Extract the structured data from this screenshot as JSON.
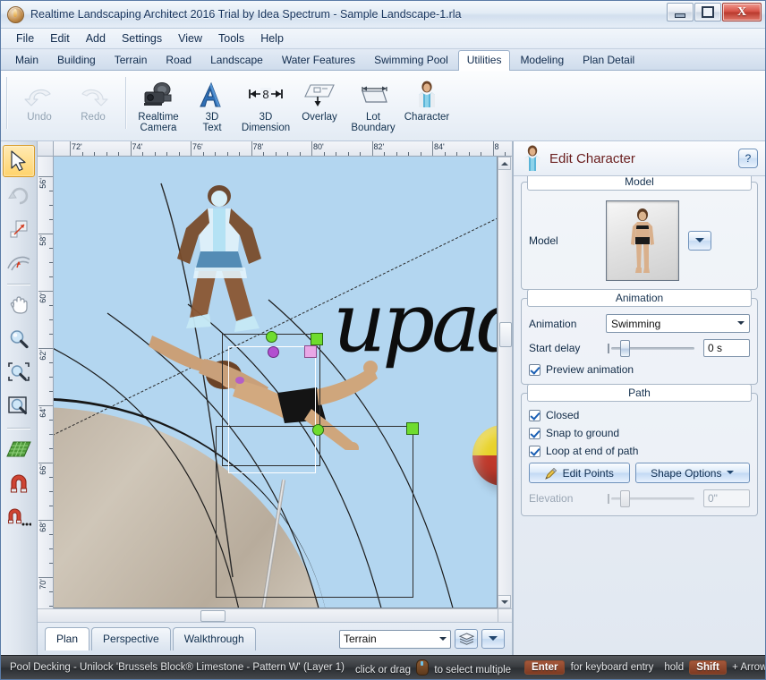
{
  "window": {
    "title": "Realtime Landscaping Architect 2016 Trial by Idea Spectrum - Sample Landscape-1.rla",
    "app_icon": "flame-icon",
    "minimize_label": "",
    "maximize_label": "",
    "close_label": "X"
  },
  "menubar": {
    "items": [
      {
        "label": "File"
      },
      {
        "label": "Edit"
      },
      {
        "label": "Add"
      },
      {
        "label": "Settings"
      },
      {
        "label": "View"
      },
      {
        "label": "Tools"
      },
      {
        "label": "Help"
      }
    ]
  },
  "ribbon": {
    "tabs": [
      {
        "label": "Main",
        "active": false
      },
      {
        "label": "Building",
        "active": false
      },
      {
        "label": "Terrain",
        "active": false
      },
      {
        "label": "Road",
        "active": false
      },
      {
        "label": "Landscape",
        "active": false
      },
      {
        "label": "Water Features",
        "active": false
      },
      {
        "label": "Swimming Pool",
        "active": false
      },
      {
        "label": "Utilities",
        "active": true
      },
      {
        "label": "Modeling",
        "active": false
      },
      {
        "label": "Plan Detail",
        "active": false
      }
    ]
  },
  "toolbar": {
    "buttons": [
      {
        "label": "Undo",
        "icon": "undo-arrow-icon",
        "disabled": true
      },
      {
        "label": "Redo",
        "icon": "redo-arrow-icon",
        "disabled": true
      },
      {
        "label": "Realtime\nCamera",
        "line1": "Realtime",
        "line2": "Camera",
        "icon": "video-camera-icon",
        "disabled": false
      },
      {
        "label": "3D Text",
        "line1": "3D",
        "line2": "Text",
        "icon": "letter-a-icon",
        "disabled": false
      },
      {
        "label": "3D Dimension",
        "line1": "3D",
        "line2": "Dimension",
        "icon": "dimension-arrows-icon",
        "disabled": false
      },
      {
        "label": "Overlay",
        "line1": "Overlay",
        "line2": "",
        "icon": "overlay-plan-icon",
        "disabled": false
      },
      {
        "label": "Lot Boundary",
        "line1": "Lot",
        "line2": "Boundary",
        "icon": "lot-boundary-icon",
        "disabled": false
      },
      {
        "label": "Character",
        "line1": "Character",
        "line2": "",
        "icon": "person-icon",
        "disabled": false
      }
    ],
    "dimension_value": "8"
  },
  "tools": [
    {
      "name": "select-arrow-tool",
      "active": true
    },
    {
      "name": "rotate-tool",
      "active": false
    },
    {
      "name": "scale-tool",
      "active": false
    },
    {
      "name": "curve-tool",
      "active": false
    },
    {
      "name": "pan-hand-tool",
      "active": false
    },
    {
      "name": "zoom-tool",
      "active": false
    },
    {
      "name": "zoom-region-tool",
      "active": false
    },
    {
      "name": "zoom-window-tool",
      "active": false
    },
    {
      "name": "grid-tool",
      "active": false
    },
    {
      "name": "magnet-snap-tool",
      "active": false
    },
    {
      "name": "magnet-options-tool",
      "active": false
    }
  ],
  "rulers": {
    "horizontal": [
      "72'",
      "74'",
      "76'",
      "78'",
      "80'",
      "82'",
      "84'",
      "8"
    ],
    "vertical": [
      "56'",
      "58'",
      "60'",
      "62'",
      "64'",
      "66'",
      "68'",
      "70'"
    ]
  },
  "canvas": {
    "overlay_text": "upad",
    "objects": [
      "character-standing",
      "character-swimming",
      "beach-ball",
      "pool-deck",
      "path-curves",
      "pole"
    ]
  },
  "viewbar": {
    "tabs": [
      {
        "label": "Plan",
        "active": true
      },
      {
        "label": "Perspective",
        "active": false
      },
      {
        "label": "Walkthrough",
        "active": false
      }
    ],
    "layer_combo_value": "Terrain",
    "layers_icon": "layers-stack-icon",
    "dropdown_icon": "chevron-down-icon"
  },
  "panel": {
    "title": "Edit Character",
    "icon": "character-person-icon",
    "help_label": "?",
    "model": {
      "group_title": "Model",
      "label": "Model",
      "thumbnail": "woman-swimsuit-thumbnail",
      "dropdown_icon": "chevron-down-icon"
    },
    "animation": {
      "group_title": "Animation",
      "animation_label": "Animation",
      "animation_value": "Swimming",
      "start_delay_label": "Start delay",
      "start_delay_value": "0 s",
      "preview_label": "Preview animation",
      "preview_checked": true
    },
    "path": {
      "group_title": "Path",
      "closed_label": "Closed",
      "closed_checked": true,
      "snap_label": "Snap to ground",
      "snap_checked": true,
      "loop_label": "Loop at end of path",
      "loop_checked": true,
      "edit_points_label": "Edit Points",
      "edit_points_icon": "pencil-icon",
      "shape_options_label": "Shape Options",
      "shape_options_icon": "chevron-down-icon",
      "elevation_label": "Elevation",
      "elevation_value": "0\"",
      "elevation_disabled": true
    }
  },
  "statusbar": {
    "selection": "Pool Decking - Unilock 'Brussels Block® Limestone - Pattern W' (Layer 1)",
    "hint_click": "click or drag",
    "hint_click_tail": "to select multiple",
    "key_enter": "Enter",
    "hint_enter": "for keyboard entry",
    "hint_hold": "hold",
    "key_shift": "Shift",
    "hint_nudge": "+ Arrow key to nudge",
    "mouse_icon": "mouse-icon"
  }
}
